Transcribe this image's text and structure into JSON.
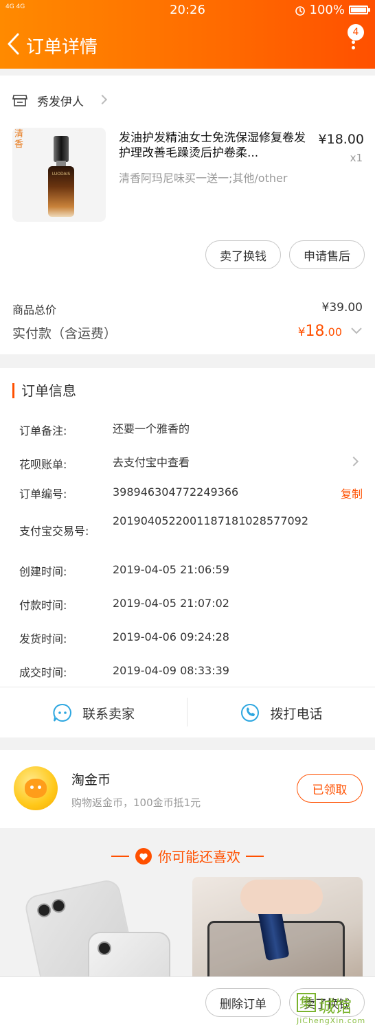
{
  "status_bar": {
    "network": "4G 4G",
    "time": "20:26",
    "battery": "100%"
  },
  "header": {
    "title": "订单详情",
    "badge": "4"
  },
  "shop": {
    "name": "秀发伊人"
  },
  "product": {
    "tag": "清香",
    "image_label": "LUODAIS",
    "title": "发油护发精油女士免洗保湿修复卷发护理改善毛躁烫后护卷柔...",
    "price": "¥18.00",
    "qty": "x1",
    "sku": "清香阿玛尼味买一送一;其他/other"
  },
  "item_actions": {
    "sell_label": "卖了换钱",
    "after_sale_label": "申请售后"
  },
  "summary": {
    "total_label": "商品总价",
    "total_value": "¥39.00",
    "paid_label": "实付款（含运费）",
    "paid_currency": "¥",
    "paid_int": "18",
    "paid_dec": ".00"
  },
  "order_info": {
    "title": "订单信息",
    "note_label": "订单备注:",
    "note_value": "还要一个雅香的",
    "huabei_label": "花呗账单:",
    "huabei_value": "去支付宝中查看",
    "order_no_label": "订单编号:",
    "order_no_value": "398946304772249366",
    "copy_label": "复制",
    "alipay_label": "支付宝交易号:",
    "alipay_value": "2019040522001187181028577092",
    "created_label": "创建时间:",
    "created_value": "2019-04-05 21:06:59",
    "paid_label": "付款时间:",
    "paid_value": "2019-04-05 21:07:02",
    "shipped_label": "发货时间:",
    "shipped_value": "2019-04-06 09:24:28",
    "closed_label": "成交时间:",
    "closed_value": "2019-04-09 08:33:39"
  },
  "contact": {
    "seller_label": "联系卖家",
    "phone_label": "拨打电话"
  },
  "coins": {
    "title": "淘金币",
    "subtitle": "购物返金币，100金币抵1元",
    "button_label": "已领取"
  },
  "recommend": {
    "title": "你可能还喜欢"
  },
  "bottom_bar": {
    "delete_label": "删除订单",
    "sell_label": "卖了换钱"
  },
  "watermark": {
    "char": "集",
    "text": "城馆",
    "site": "JiChengXin.com"
  },
  "colors": {
    "accent": "#ff5000",
    "header_start": "#ff8a00"
  }
}
